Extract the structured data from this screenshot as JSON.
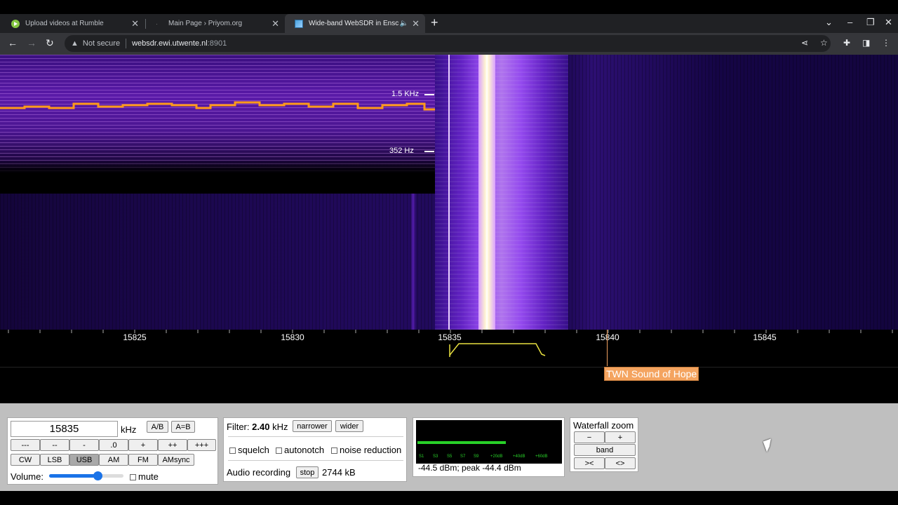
{
  "browser": {
    "tabs": [
      {
        "title": "Upload videos at Rumble",
        "active": false
      },
      {
        "title": "Main Page › Priyom.org",
        "active": false
      },
      {
        "title": "Wide-band WebSDR in Ensche",
        "active": true,
        "audio": true
      }
    ],
    "url_security": "Not secure",
    "url_host": "websdr.ewi.utwente.nl",
    "url_port": ":8901"
  },
  "waterfall": {
    "spectrogram_labels": [
      "1.5  KHz",
      "352  Hz"
    ]
  },
  "scale": {
    "ticks": [
      "15825",
      "15830",
      "15835",
      "15840",
      "15845"
    ],
    "station_label": "TWN Sound of Hope"
  },
  "tuning": {
    "frequency": "15835",
    "unit": "kHz",
    "ab_label": "A/B",
    "aeqb_label": "A=B",
    "step_buttons": [
      "---",
      "--",
      "-",
      ".0",
      "+",
      "++",
      "+++"
    ],
    "modes": [
      "CW",
      "LSB",
      "USB",
      "AM",
      "FM",
      "AMsync"
    ],
    "selected_mode": "USB",
    "volume_label": "Volume:",
    "volume_level": 0.65,
    "mute_label": "mute"
  },
  "filter": {
    "label": "Filter:",
    "value": "2.40",
    "unit": "kHz",
    "narrower_label": "narrower",
    "wider_label": "wider",
    "squelch_label": "squelch",
    "autonotch_label": "autonotch",
    "noise_reduction_label": "noise reduction",
    "recording_label": "Audio recording",
    "stop_label": "stop",
    "recording_size": "2744 kB"
  },
  "smeter": {
    "scale": [
      "S1",
      "S3",
      "S5",
      "S7",
      "S9",
      "+20dB",
      "+40dB",
      "+60dB"
    ],
    "reading": "-44.5 dBm; peak  -44.4 dBm",
    "level": 0.63
  },
  "zoom": {
    "title": "Waterfall zoom",
    "minus_label": "−",
    "plus_label": "+",
    "band_label": "band",
    "narrow_label": "><",
    "wide_label": "<>"
  },
  "colors": {
    "accent": "#1a73e8",
    "station_tag": "#f4a460",
    "filter_outline": "#e8e040",
    "smeter_green": "#28d028"
  }
}
